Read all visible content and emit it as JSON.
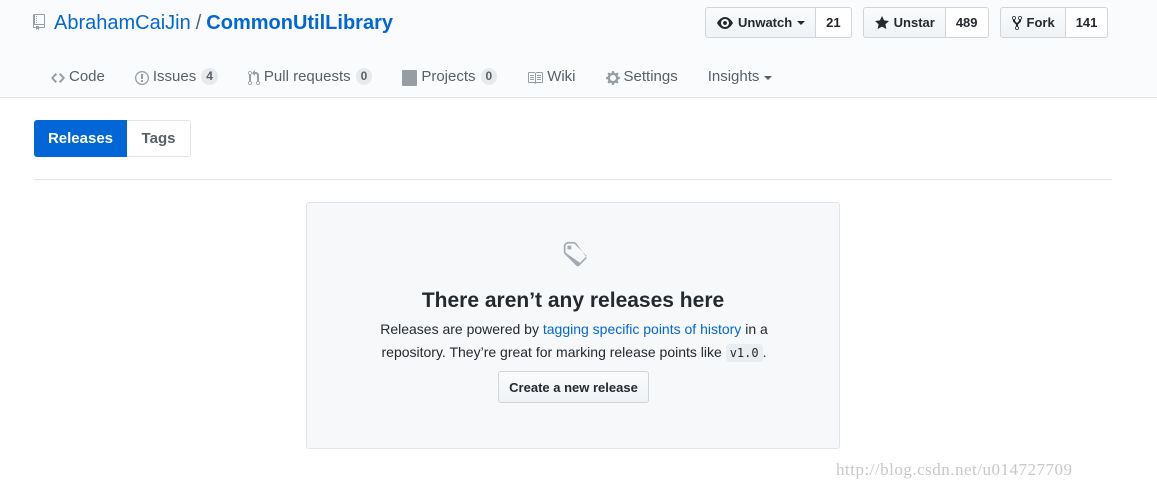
{
  "repo": {
    "owner": "AbrahamCaiJin",
    "separator": "/",
    "name": "CommonUtilLibrary"
  },
  "actions": {
    "watch": {
      "label": "Unwatch",
      "count": "21"
    },
    "star": {
      "label": "Unstar",
      "count": "489"
    },
    "fork": {
      "label": "Fork",
      "count": "141"
    }
  },
  "nav": {
    "code": "Code",
    "issues": "Issues",
    "issues_count": "4",
    "pulls": "Pull requests",
    "pulls_count": "0",
    "projects": "Projects",
    "projects_count": "0",
    "wiki": "Wiki",
    "settings": "Settings",
    "insights": "Insights"
  },
  "subnav": {
    "releases": "Releases",
    "tags": "Tags"
  },
  "blankslate": {
    "title": "There aren’t any releases here",
    "desc_prefix": "Releases are powered by ",
    "desc_link": "tagging specific points of history",
    "desc_middle": " in a repository. They’re great for marking release points like ",
    "desc_code": "v1.0",
    "desc_suffix": ".",
    "button": "Create a new release"
  },
  "watermark": "http://blog.csdn.net/u014727709",
  "colors": {
    "accent": "#0366d6",
    "header_bg": "#fafbfc",
    "blankslate_bg": "#f6f8fa"
  },
  "icons": [
    "repo-icon",
    "eye-icon",
    "star-icon",
    "fork-icon",
    "code-icon",
    "issue-icon",
    "pull-request-icon",
    "project-icon",
    "book-icon",
    "gear-icon",
    "tag-icon"
  ]
}
